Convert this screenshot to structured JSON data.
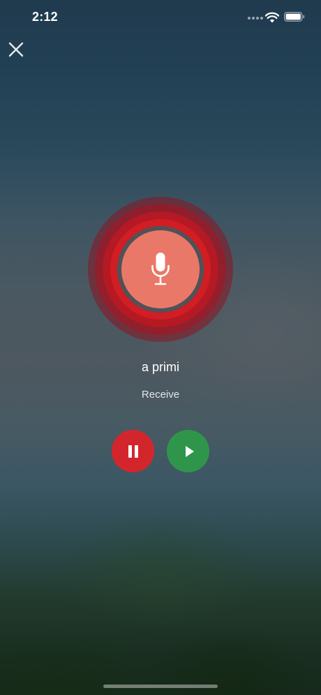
{
  "status_bar": {
    "time": "2:12",
    "icons": [
      "cellular-signal-icon",
      "wifi-icon",
      "battery-icon"
    ]
  },
  "close": {
    "icon": "close-icon"
  },
  "recorder": {
    "icon": "microphone-icon",
    "state": "listening",
    "accent": "#d11d24",
    "button_color": "#ea7868"
  },
  "word": {
    "text": "a primi"
  },
  "mode": {
    "text": "Receive"
  },
  "controls": {
    "pause": {
      "icon": "pause-icon",
      "color": "#d3262c"
    },
    "play": {
      "icon": "play-icon",
      "color": "#2f954a"
    }
  }
}
